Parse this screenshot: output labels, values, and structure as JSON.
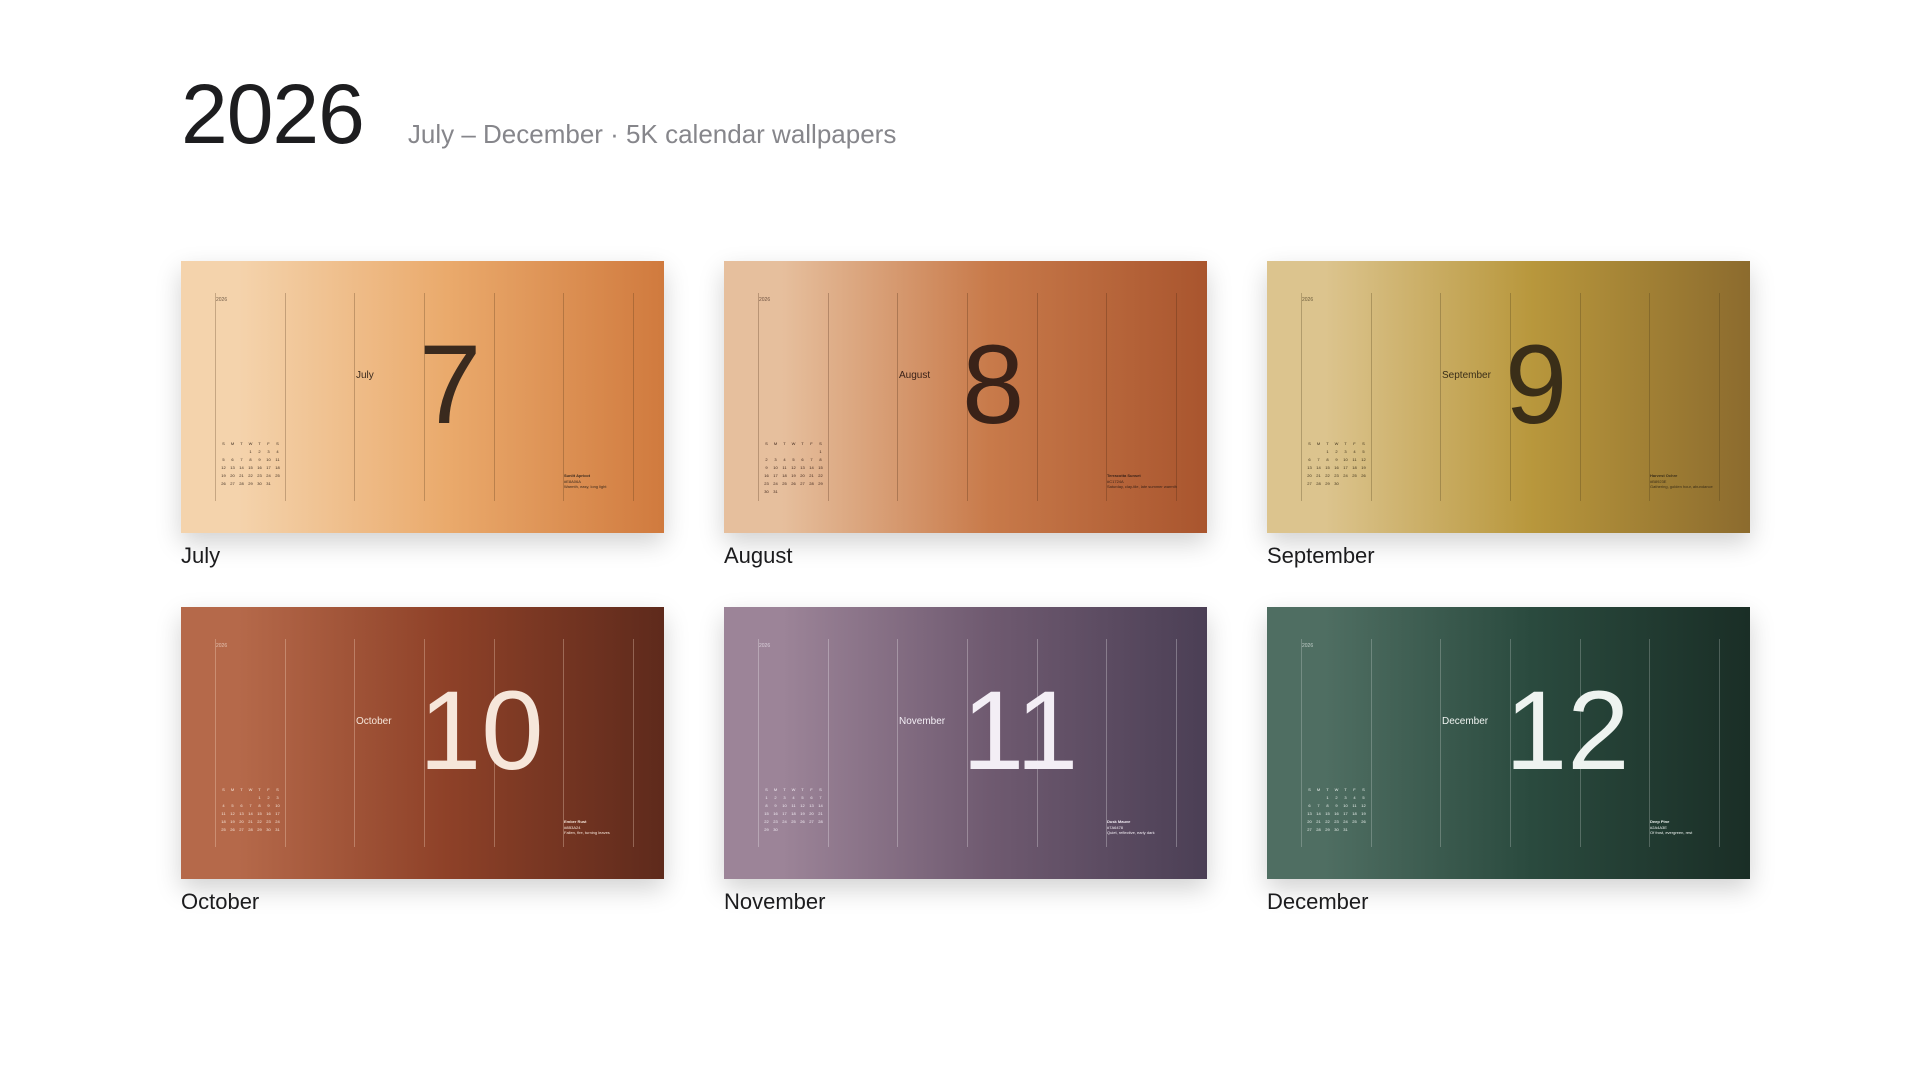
{
  "header": {
    "year": "2026",
    "subtitle": "July – December · 5K calendar wallpapers"
  },
  "cards": [
    {
      "label": "July",
      "month": "July",
      "number": "7",
      "year": "2026",
      "gradient": [
        "#f4d3ac",
        "#eaaa6c",
        "#d07a3e"
      ],
      "ink": "#3a2a1e",
      "line": "rgba(80,50,20,0.28)",
      "color_name": "Sunlit Apricot",
      "color_hex": "#E8A06A",
      "color_note": "Warmth, easy, long light"
    },
    {
      "label": "August",
      "month": "August",
      "number": "8",
      "year": "2026",
      "gradient": [
        "#e6bf9d",
        "#c87a4a",
        "#a9552e"
      ],
      "ink": "#3a2218",
      "line": "rgba(70,35,15,0.28)",
      "color_name": "Terracotta Sunset",
      "color_hex": "#C1724A",
      "color_note": "Saturday, clay-tile, late summer warmth"
    },
    {
      "label": "September",
      "month": "September",
      "number": "9",
      "year": "2026",
      "gradient": [
        "#dcc48e",
        "#b8973c",
        "#8c6b2e"
      ],
      "ink": "#3a2e18",
      "line": "rgba(70,55,20,0.28)",
      "color_name": "Harvest Ochre",
      "color_hex": "#B8923E",
      "color_note": "Gathering, golden hour, abundance"
    },
    {
      "label": "October",
      "month": "October",
      "number": "10",
      "year": "2026",
      "gradient": [
        "#b5694a",
        "#8e4128",
        "#5e2a1c"
      ],
      "ink": "#f6e6da",
      "line": "rgba(255,230,210,0.30)",
      "color_name": "Ember Rust",
      "color_hex": "#8B3A24",
      "color_note": "Fallen, fire, turning leaves"
    },
    {
      "label": "November",
      "month": "November",
      "number": "11",
      "year": "2026",
      "gradient": [
        "#9c8498",
        "#6f5a70",
        "#4b3f55"
      ],
      "ink": "#f3eef5",
      "line": "rgba(255,255,255,0.28)",
      "color_name": "Dusk Mauve",
      "color_hex": "#7A6478",
      "color_note": "Quiet, reflective, early dark"
    },
    {
      "label": "December",
      "month": "December",
      "number": "12",
      "year": "2026",
      "gradient": [
        "#4f6e62",
        "#2a4a3e",
        "#1a2e26"
      ],
      "ink": "#eef3f0",
      "line": "rgba(255,255,255,0.22)",
      "color_name": "Deep Pine",
      "color_hex": "#2A4A3E",
      "color_note": "Of frost, evergreen, rest"
    }
  ]
}
